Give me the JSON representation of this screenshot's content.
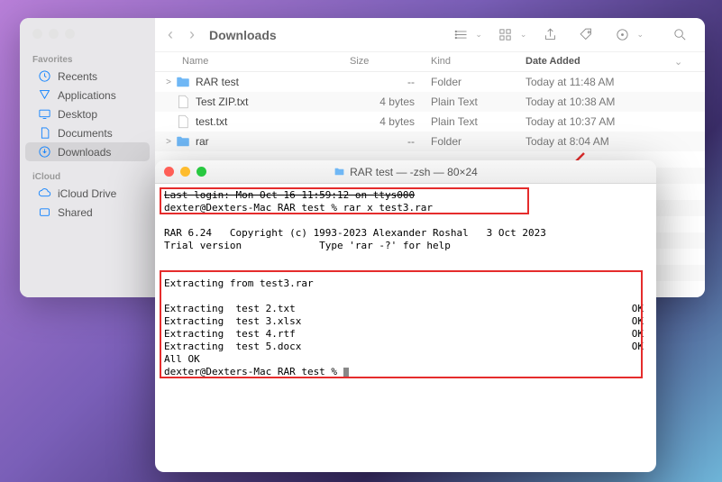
{
  "finder": {
    "title": "Downloads",
    "sidebar": {
      "section1": "Favorites",
      "items1": [
        {
          "label": "Recents",
          "icon": "clock"
        },
        {
          "label": "Applications",
          "icon": "apps"
        },
        {
          "label": "Desktop",
          "icon": "desktop"
        },
        {
          "label": "Documents",
          "icon": "doc"
        },
        {
          "label": "Downloads",
          "icon": "download",
          "active": true
        }
      ],
      "section2": "iCloud",
      "items2": [
        {
          "label": "iCloud Drive",
          "icon": "cloud"
        },
        {
          "label": "Shared",
          "icon": "shared"
        }
      ]
    },
    "columns": {
      "name": "Name",
      "size": "Size",
      "kind": "Kind",
      "date": "Date Added"
    },
    "rows": [
      {
        "disclosure": ">",
        "type": "folder",
        "name": "RAR test",
        "size": "--",
        "kind": "Folder",
        "date": "Today at 11:48 AM"
      },
      {
        "disclosure": "",
        "type": "txt",
        "name": "Test ZIP.txt",
        "size": "4 bytes",
        "kind": "Plain Text",
        "date": "Today at 10:38 AM"
      },
      {
        "disclosure": "",
        "type": "txt",
        "name": "test.txt",
        "size": "4 bytes",
        "kind": "Plain Text",
        "date": "Today at 10:37 AM"
      },
      {
        "disclosure": ">",
        "type": "folder",
        "name": "rar",
        "size": "--",
        "kind": "Folder",
        "date": "Today at 8:04 AM"
      }
    ]
  },
  "terminal": {
    "title": "RAR test — -zsh — 80×24",
    "line_strike": "Last login: Mon Oct 16 11:59:12 on ttys000",
    "line_cmd": "dexter@Dexters-Mac RAR test % rar x test3.rar",
    "blank": "",
    "line_rar1": "RAR 6.24   Copyright (c) 1993-2023 Alexander Roshal   3 Oct 2023",
    "line_rar2": "Trial version             Type 'rar -?' for help",
    "line_extfrom": "Extracting from test3.rar",
    "ext_label": "Extracting  ",
    "ok": "OK",
    "files": [
      "test 2.txt",
      "test 3.xlsx",
      "test 4.rtf",
      "test 5.docx"
    ],
    "allok": "All OK",
    "prompt": "dexter@Dexters-Mac RAR test % "
  }
}
